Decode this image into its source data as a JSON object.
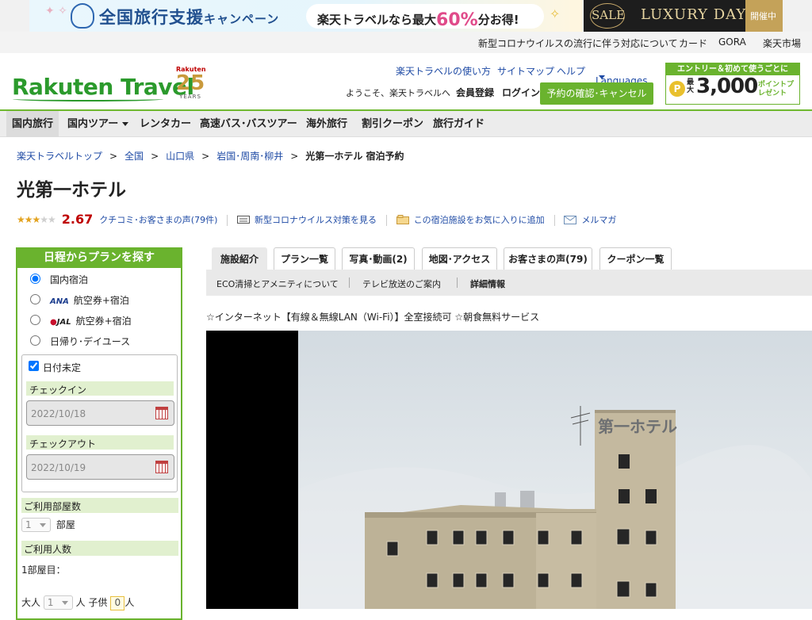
{
  "banner": {
    "campaign_title": "全国旅行支援",
    "campaign_suffix": "キャンペーン",
    "pill_prefix": "楽天トラベルなら最大",
    "pill_pct": "60%",
    "pill_suffix": "分お得!",
    "sale": "SALE",
    "luxury": "LUXURY DAYS",
    "held": "開催中"
  },
  "utility": {
    "covid": "新型コロナウイルスの流行に伴う対応について",
    "card": "カード",
    "gora": "GORA",
    "ichiba": "楽天市場"
  },
  "header": {
    "logo": "Rakuten Travel",
    "years_brand": "Rakuten",
    "years_num": "25",
    "years_label": "YEARS",
    "links": [
      "楽天トラベルの使い方",
      "サイトマップ",
      "ヘルプ",
      "Languages"
    ],
    "welcome": "ようこそ、楽天トラベルへ",
    "register": "会員登録",
    "login": "ログイン",
    "confirm": "予約の確認･キャンセル",
    "promo_top": "エントリー＆初めて使うごとに",
    "promo_max": "最大",
    "promo_amount": "3,000",
    "promo_points": "ポイントプレゼント",
    "promo_coin": "P"
  },
  "nav": [
    "国内旅行",
    "国内ツアー",
    "レンタカー",
    "高速バス･バスツアー",
    "海外旅行",
    "割引クーポン",
    "旅行ガイド"
  ],
  "breadcrumb": {
    "items": [
      "楽天トラベルトップ",
      "全国",
      "山口県",
      "岩国･周南･柳井"
    ],
    "current": "光第一ホテル 宿泊予約",
    "sep": ">"
  },
  "hotel": {
    "name": "光第一ホテル",
    "rating": 2.67,
    "rating_text": "2.67",
    "reviews_link": "クチコミ･お客さまの声(79件)",
    "covid_link": "新型コロナウイルス対策を見る",
    "fav_link": "この宿泊施設をお気に入りに追加",
    "mail_link": "メルマガ",
    "description": "☆インターネット【有線＆無線LAN（Wi-Fi）】全室接続可 ☆朝食無料サービス",
    "sign": "第一ホテル"
  },
  "sidebar": {
    "title": "日程からプランを探す",
    "options": [
      {
        "airline": "",
        "label": "国内宿泊",
        "selected": true
      },
      {
        "airline": "ANA",
        "label": "航空券+宿泊",
        "selected": false
      },
      {
        "airline": "JAL",
        "label": "航空券+宿泊",
        "selected": false
      },
      {
        "airline": "",
        "label": "日帰り･デイユース",
        "selected": false
      }
    ],
    "undecided_label": "日付未定",
    "undecided_checked": true,
    "checkin_label": "チェックイン",
    "checkin_value": "2022/10/18",
    "checkout_label": "チェックアウト",
    "checkout_value": "2022/10/19",
    "rooms_label": "ご利用部屋数",
    "rooms_value": "1",
    "rooms_unit": "部屋",
    "people_label": "ご利用人数",
    "room1_label": "1部屋目：",
    "adult_label": "大人",
    "adult_value": "1",
    "person_unit": "人",
    "child_label": "子供",
    "child_value": "0"
  },
  "tabs": [
    "施設紹介",
    "プラン一覧",
    "写真･動画(2)",
    "地図･アクセス",
    "お客さまの声(79)",
    "クーポン一覧"
  ],
  "subtabs": [
    "ECO清掃とアメニティについて",
    "テレビ放送のご案内",
    "詳細情報"
  ],
  "colors": {
    "brand_green": "#6ab32e",
    "link_blue": "#1f4ba5",
    "rating_red": "#bf0000",
    "star_gold": "#e3a320"
  }
}
